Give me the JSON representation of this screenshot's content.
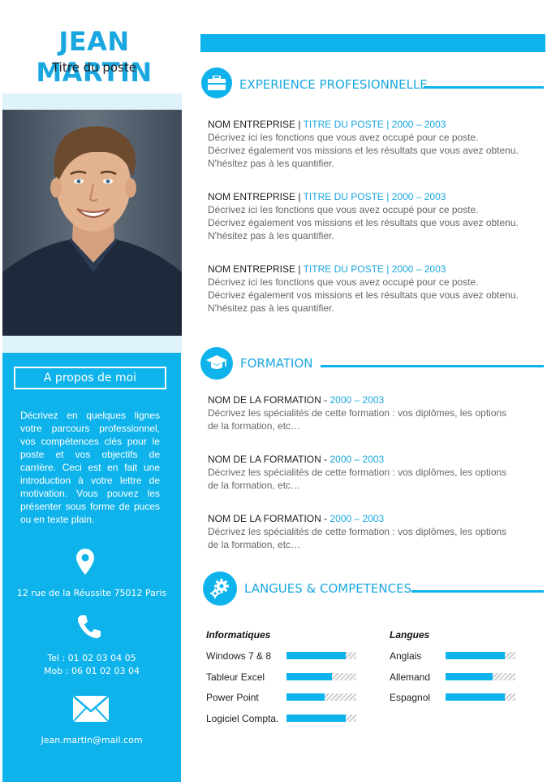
{
  "header": {
    "name": "JEAN MARTIN",
    "role": "Titre du poste"
  },
  "sidebar": {
    "about_title": "A propos de moi",
    "about_text": "Décrivez en quelques lignes votre parcours professionnel, vos compétences clés pour le poste et vos objectifs de carrière. Ceci est en fait une introduction à votre lettre de motivation. Vous pouvez les présenter sous forme de puces ou en texte plain.",
    "address": "12 rue de la Réussite 75012 Paris",
    "tel": "Tel : 01 02 03 04 05",
    "mob": "Mob : 06 01 02 03 04",
    "email": "Jean.martin@mail.com"
  },
  "experience": {
    "title": "EXPERIENCE PROFESIONNELLE",
    "items": [
      {
        "company": "NOM ENTREPRISE",
        "sep": " | ",
        "position": "TITRE DU POSTE | 2000 – 2003",
        "line1": "Décrivez ici les fonctions que vous avez occupé pour ce poste.",
        "line2": "Décrivez également vos missions et les résultats que vous avez obtenu.",
        "line3": "N'hésitez pas à les quantifier."
      },
      {
        "company": "NOM ENTREPRISE",
        "sep": " | ",
        "position": "TITRE DU POSTE | 2000 – 2003",
        "line1": "Décrivez ici les fonctions que vous avez occupé pour ce poste.",
        "line2": "Décrivez également vos missions et les résultats que vous avez obtenu.",
        "line3": "N'hésitez pas à les quantifier."
      },
      {
        "company": "NOM ENTREPRISE",
        "sep": " | ",
        "position": "TITRE DU POSTE | 2000 – 2003",
        "line1": "Décrivez ici les fonctions que vous avez occupé pour ce poste.",
        "line2": "Décrivez également vos missions et les résultats que vous avez obtenu.",
        "line3": "N'hésitez pas à les quantifier."
      }
    ]
  },
  "formation": {
    "title": "FORMATION",
    "items": [
      {
        "name": "NOM DE LA FORMATION",
        "sep": " - ",
        "years": "2000 – 2003",
        "line1": "Décrivez les spécialités de cette formation : vos diplômes, les options",
        "line2": "de la formation, etc…"
      },
      {
        "name": "NOM DE LA FORMATION",
        "sep": " - ",
        "years": "2000 – 2003",
        "line1": "Décrivez les spécialités de cette formation : vos diplômes, les options",
        "line2": "de la formation, etc…"
      },
      {
        "name": "NOM DE LA FORMATION",
        "sep": " - ",
        "years": "2000 – 2003",
        "line1": "Décrivez les spécialités de cette formation : vos diplômes, les options",
        "line2": "de la formation, etc…"
      }
    ]
  },
  "skills": {
    "title": "LANGUES & COMPETENCES",
    "informatique_title": "Informatiques",
    "informatique": [
      {
        "label": "Windows 7 & 8",
        "level": 0.85
      },
      {
        "label": "Tableur Excel",
        "level": 0.65
      },
      {
        "label": "Power Point",
        "level": 0.55
      },
      {
        "label": "Logiciel Compta.",
        "level": 0.85
      }
    ],
    "langues_title": "Langues",
    "langues": [
      {
        "label": "Anglais",
        "level": 0.85
      },
      {
        "label": "Allemand",
        "level": 0.68
      },
      {
        "label": "Espagnol",
        "level": 0.85
      }
    ]
  },
  "colors": {
    "accent": "#0fb3ec",
    "title_blue": "#1aa7e0"
  },
  "icons": [
    "briefcase-icon",
    "graduation-cap-icon",
    "gears-icon",
    "map-pin-icon",
    "phone-icon",
    "envelope-icon"
  ]
}
